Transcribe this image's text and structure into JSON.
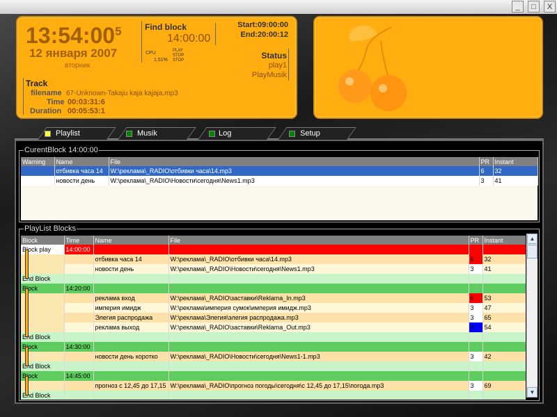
{
  "window": {
    "minimize_label": "_",
    "maximize_label": "□",
    "close_label": "X"
  },
  "clock": {
    "time": "13:54:00",
    "seconds_sup": "5",
    "date": "12 января 2007",
    "weekday": "вторник",
    "find_block_label": "Find block",
    "find_block_time": "14:00:00",
    "cpu_label": "CPU",
    "cpu_value": "1,51%",
    "play_label": "PLAY",
    "stop_label": "STOP",
    "stop2_label": "STOP",
    "start": "Start:09:00:00",
    "end": "End:20:00:12",
    "status_label": "Status",
    "status_line1": "play1",
    "status_line2": "PlayMusik",
    "track_label": "Track",
    "filename_label": "filename",
    "filename_value": "67-Unknown-Takaju kaja kajaja.mp3",
    "time_label": "Time",
    "time_value": "00:03:31:6",
    "duration_label": "Duration",
    "duration_value": "00:05:53:1"
  },
  "colors": {
    "accent": "#ffad0f",
    "selection": "#3168c6",
    "block_active": "#ff0000",
    "block_header": "#5ecc5e"
  },
  "tabs": [
    {
      "label": "Playlist",
      "indicator": "#ffff44"
    },
    {
      "label": "Musik",
      "indicator": "#008800"
    },
    {
      "label": "Log",
      "indicator": "#008800"
    },
    {
      "label": "Setup",
      "indicator": "#008800"
    }
  ],
  "current_block": {
    "title": "CurentBlock 14:00:00",
    "headers": [
      "Warning",
      "Name",
      "File",
      "PR",
      "Instant"
    ],
    "rows": [
      {
        "warning": "",
        "name": "отбивка часа 14",
        "file": "W:\\реклама\\_RADIO\\отбивки часа\\14.mp3",
        "pr": "6",
        "instant": "32"
      },
      {
        "warning": "",
        "name": "новости день",
        "file": "W:\\реклама\\_RADIO\\Новости\\сегодня\\News1.mp3",
        "pr": "3",
        "instant": "41"
      }
    ]
  },
  "playlist": {
    "title": "PlayList Blocks",
    "headers": [
      "Block",
      "Time",
      "Name",
      "File",
      "PR",
      "Instant"
    ],
    "rows": [
      {
        "type": "head-red",
        "block": "Block play",
        "time": "14:00:00",
        "name": "",
        "file": "",
        "pr": "",
        "instant": ""
      },
      {
        "type": "item",
        "block": "",
        "time": "",
        "name": "отбивка часа 14",
        "file": "W:\\реклама\\_RADIO\\отбивки часа\\14.mp3",
        "pr": "6",
        "instant": "32",
        "pr_color": "red"
      },
      {
        "type": "item",
        "block": "",
        "time": "",
        "name": "новости день",
        "file": "W:\\реклама\\_RADIO\\Новости\\сегодня\\News1.mp3",
        "pr": "3",
        "instant": "41",
        "pr_color": "white"
      },
      {
        "type": "end",
        "block": "End Block",
        "time": "",
        "name": "",
        "file": "",
        "pr": "",
        "instant": ""
      },
      {
        "type": "head-green",
        "block": "Block",
        "time": "14:20:00",
        "name": "",
        "file": "",
        "pr": "",
        "instant": ""
      },
      {
        "type": "item",
        "block": "",
        "time": "",
        "name": "реклама вход",
        "file": "W:\\реклама\\_RADIO\\заставки\\Reklama_In.mp3",
        "pr": "6",
        "instant": "53",
        "pr_color": "red"
      },
      {
        "type": "item",
        "block": "",
        "time": "",
        "name": "империя имидж",
        "file": "W:\\реклама\\империя сумок\\империя имидж.mp3",
        "pr": "3",
        "instant": "47",
        "pr_color": "white"
      },
      {
        "type": "item",
        "block": "",
        "time": "",
        "name": "Элегия распродажа",
        "file": "W:\\реклама\\Элегия\\элегия распродажа.mp3",
        "pr": "3",
        "instant": "65",
        "pr_color": "white"
      },
      {
        "type": "item",
        "block": "",
        "time": "",
        "name": "реклама выход",
        "file": "W:\\реклама\\_RADIO\\заставки\\Reklama_Out.mp3",
        "pr": "9",
        "instant": "54",
        "pr_color": "blue"
      },
      {
        "type": "end",
        "block": "End Block",
        "time": "",
        "name": "",
        "file": "",
        "pr": "",
        "instant": ""
      },
      {
        "type": "head-green",
        "block": "Block",
        "time": "14:30:00",
        "name": "",
        "file": "",
        "pr": "",
        "instant": ""
      },
      {
        "type": "item",
        "block": "",
        "time": "",
        "name": "новости день коротко",
        "file": "W:\\реклама\\_RADIO\\Новости\\сегодня\\News1-1.mp3",
        "pr": "3",
        "instant": "42",
        "pr_color": "white"
      },
      {
        "type": "end",
        "block": "End Block",
        "time": "",
        "name": "",
        "file": "",
        "pr": "",
        "instant": ""
      },
      {
        "type": "head-green",
        "block": "Block",
        "time": "14:45:00",
        "name": "",
        "file": "",
        "pr": "",
        "instant": ""
      },
      {
        "type": "item",
        "block": "",
        "time": "",
        "name": "прогноз с 12,45 до 17,15",
        "file": "W:\\реклама\\_RADIO\\прогноз погоды\\сегодня\\с 12,45 до 17,15\\погода.mp3",
        "pr": "3",
        "instant": "69",
        "pr_color": "white"
      },
      {
        "type": "end",
        "block": "End Block",
        "time": "",
        "name": "",
        "file": "",
        "pr": "",
        "instant": ""
      }
    ]
  }
}
